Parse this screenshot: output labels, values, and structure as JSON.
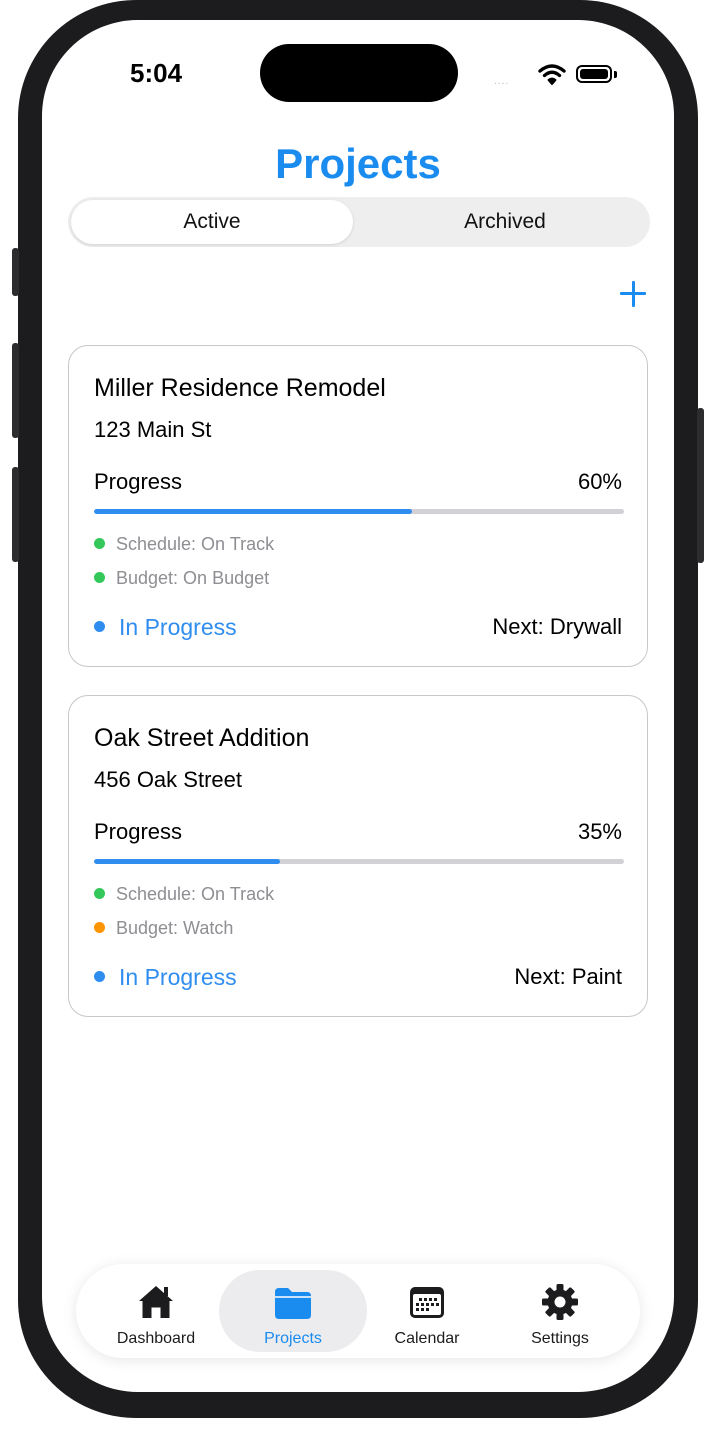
{
  "status_bar": {
    "time": "5:04",
    "signal": "....",
    "wifi_icon": "wifi-icon",
    "battery_icon": "battery-icon"
  },
  "header": {
    "title": "Projects",
    "title_color": "#1a8cf0"
  },
  "segmented": {
    "active_label": "Active",
    "archived_label": "Archived",
    "selected": "Active"
  },
  "add_button": {
    "icon": "plus-icon"
  },
  "projects": [
    {
      "name": "Miller Residence Remodel",
      "address": "123 Main St",
      "progress_label": "Progress",
      "progress_percent": "60%",
      "progress_value": 0.6,
      "schedule": {
        "text": "Schedule: On Track",
        "color": "#34c759"
      },
      "budget": {
        "text": "Budget: On Budget",
        "color": "#34c759"
      },
      "status": {
        "text": "In Progress",
        "color": "#2f8df0"
      },
      "next": "Next: Drywall"
    },
    {
      "name": "Oak Street Addition",
      "address": "456 Oak Street",
      "progress_label": "Progress",
      "progress_percent": "35%",
      "progress_value": 0.35,
      "schedule": {
        "text": "Schedule: On Track",
        "color": "#34c759"
      },
      "budget": {
        "text": "Budget: Watch",
        "color": "#ff9500"
      },
      "status": {
        "text": "In Progress",
        "color": "#2f8df0"
      },
      "next": "Next: Paint"
    }
  ],
  "tab_bar": {
    "selected": "Projects",
    "tabs": [
      {
        "label": "Dashboard",
        "icon": "house-icon"
      },
      {
        "label": "Projects",
        "icon": "folder-icon"
      },
      {
        "label": "Calendar",
        "icon": "calendar-icon"
      },
      {
        "label": "Settings",
        "icon": "gear-icon"
      }
    ]
  },
  "colors": {
    "accent": "#1a8cf0",
    "progress_track": "#d1d1d6",
    "on_track": "#34c759",
    "watch": "#ff9500"
  }
}
